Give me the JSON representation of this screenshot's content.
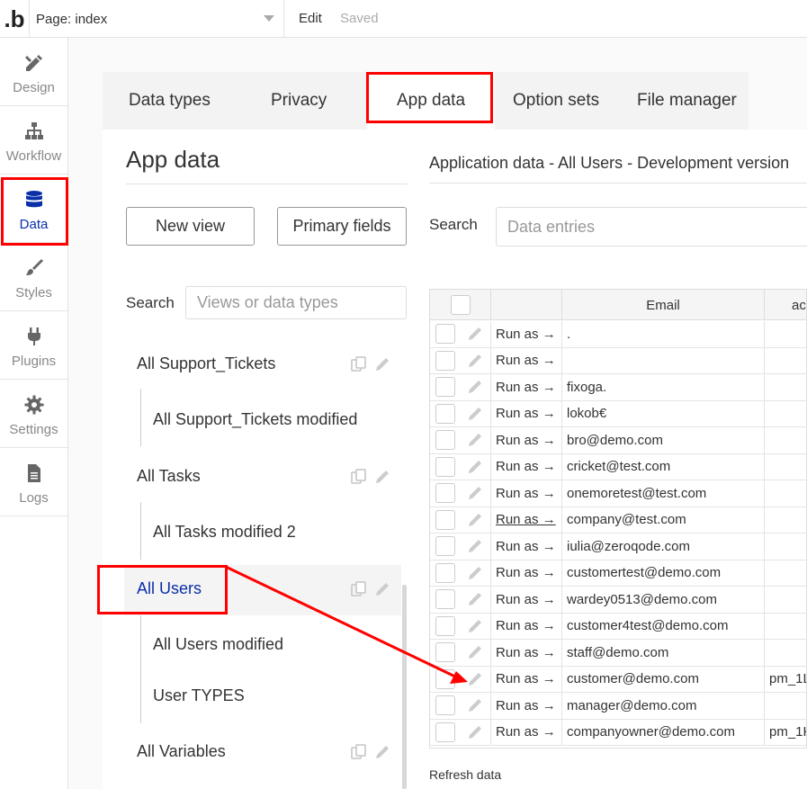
{
  "topbar": {
    "logo": ".b",
    "page_label": "Page: index",
    "edit": "Edit",
    "saved": "Saved"
  },
  "sidebar": {
    "items": [
      {
        "label": "Design",
        "icon": "design-icon"
      },
      {
        "label": "Workflow",
        "icon": "workflow-icon"
      },
      {
        "label": "Data",
        "icon": "database-icon",
        "active": true
      },
      {
        "label": "Styles",
        "icon": "brush-icon"
      },
      {
        "label": "Plugins",
        "icon": "plug-icon"
      },
      {
        "label": "Settings",
        "icon": "gear-icon"
      },
      {
        "label": "Logs",
        "icon": "document-icon"
      }
    ]
  },
  "tabs": [
    "Data types",
    "Privacy",
    "App data",
    "Option sets",
    "File manager"
  ],
  "left_panel": {
    "title": "App data",
    "new_view": "New view",
    "primary_fields": "Primary fields",
    "search_label": "Search",
    "search_placeholder": "Views or data types",
    "views": [
      {
        "label": "All Support_Tickets",
        "subs": [
          "All Support_Tickets modified"
        ]
      },
      {
        "label": "All Tasks",
        "subs": [
          "All Tasks modified 2"
        ]
      },
      {
        "label": "All Users",
        "subs": [
          "All Users modified",
          "User TYPES"
        ],
        "selected": true
      },
      {
        "label": "All Variables",
        "subs": []
      }
    ]
  },
  "right_panel": {
    "header": "Application data - All Users - Development version",
    "search_label": "Search",
    "search_placeholder": "Data entries",
    "columns": [
      "Email",
      "act"
    ],
    "run_as": "Run as →",
    "rows": [
      {
        "email": ".",
        "extra": ""
      },
      {
        "email": "",
        "extra": ""
      },
      {
        "email": "fixoga.",
        "extra": ""
      },
      {
        "email": "lokob€",
        "extra": ""
      },
      {
        "email": "bro@demo.com",
        "extra": ""
      },
      {
        "email": "cricket@test.com",
        "extra": ""
      },
      {
        "email": "onemoretest@test.com",
        "extra": ""
      },
      {
        "email": "company@test.com",
        "extra": "",
        "underline": true
      },
      {
        "email": "iulia@zeroqode.com",
        "extra": ""
      },
      {
        "email": "customertest@demo.com",
        "extra": ""
      },
      {
        "email": "wardey0513@demo.com",
        "extra": ""
      },
      {
        "email": "customer4test@demo.com",
        "extra": ""
      },
      {
        "email": "staff@demo.com",
        "extra": ""
      },
      {
        "email": "customer@demo.com",
        "extra": "pm_1L"
      },
      {
        "email": "manager@demo.com",
        "extra": ""
      },
      {
        "email": "companyowner@demo.com",
        "extra": "pm_1K"
      }
    ],
    "refresh": "Refresh data"
  },
  "colors": {
    "annotation": "#ff0000",
    "accent": "#0a2fa8"
  }
}
